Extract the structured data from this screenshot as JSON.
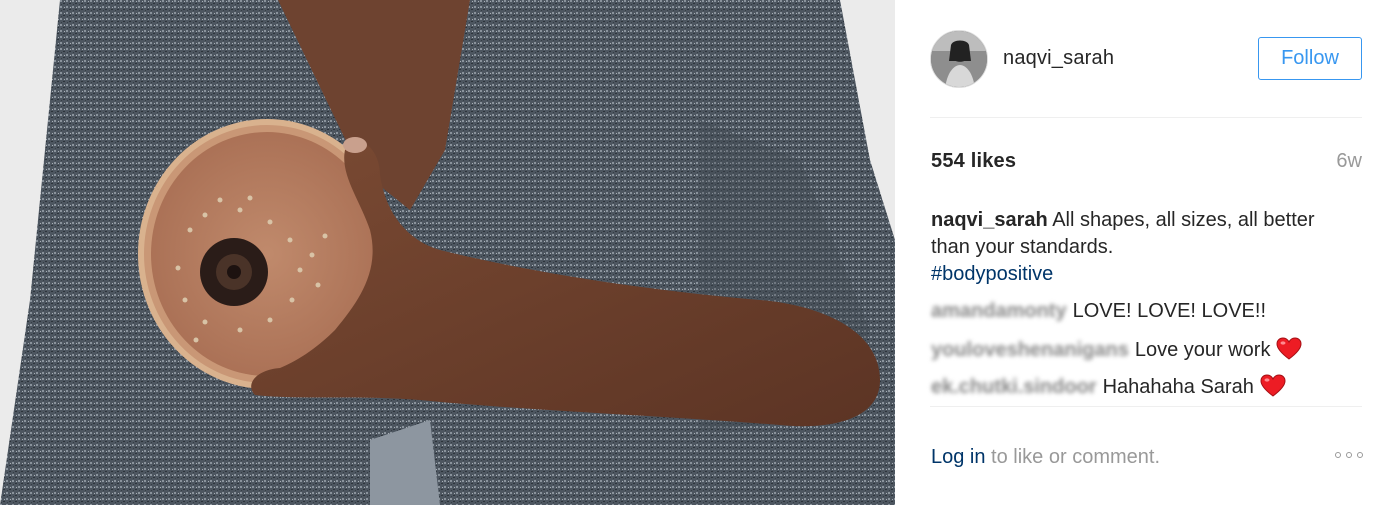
{
  "post": {
    "username": "naqvi_sarah",
    "follow_label": "Follow",
    "likes": "554 likes",
    "time_ago": "6w",
    "caption_user": "naqvi_sarah",
    "caption_text": "All shapes, all sizes, all better than your standards.",
    "hashtag": "#bodypositive"
  },
  "comments": [
    {
      "user": "amandamonty",
      "text": "LOVE! LOVE! LOVE!!",
      "heart": false
    },
    {
      "user": "youloveshenanigans",
      "text": "Love your work",
      "heart": true
    },
    {
      "user": "ek.chutki.sindoor",
      "text": "Hahahaha Sarah",
      "heart": true
    }
  ],
  "footer": {
    "login_label": "Log in",
    "rest_text": " to like or comment."
  },
  "icons": {
    "more": "more-options-icon",
    "heart": "red-heart-icon"
  },
  "colors": {
    "accent": "#3897f0",
    "link": "#003569",
    "heart": "#ed1c24"
  }
}
